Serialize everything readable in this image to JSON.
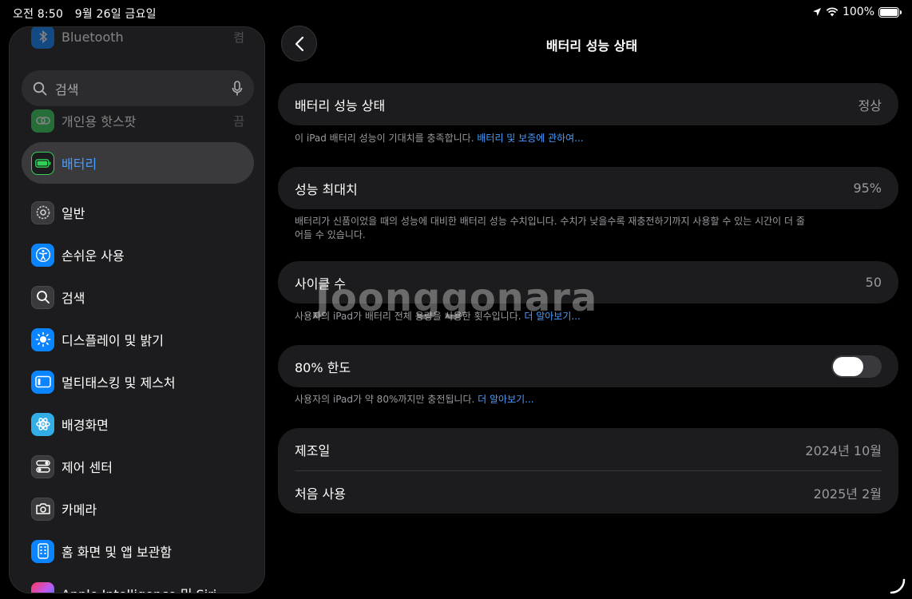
{
  "status_bar": {
    "time": "오전 8:50",
    "date": "9월 26일 금요일",
    "battery_percent": "100%"
  },
  "sidebar": {
    "search_placeholder": "검색",
    "items": [
      {
        "label": "Bluetooth",
        "value": "켬",
        "icon": "bluetooth-icon"
      },
      {
        "label": "개인용 핫스팟",
        "value": "끔",
        "icon": "link-icon"
      },
      {
        "label": "배터리",
        "value": "",
        "icon": "battery-icon",
        "selected": true
      },
      {
        "label": "일반",
        "value": "",
        "icon": "gear-icon"
      },
      {
        "label": "손쉬운 사용",
        "value": "",
        "icon": "accessibility-icon"
      },
      {
        "label": "검색",
        "value": "",
        "icon": "search-icon"
      },
      {
        "label": "디스플레이 및 밝기",
        "value": "",
        "icon": "sun-icon"
      },
      {
        "label": "멀티태스킹 및 제스처",
        "value": "",
        "icon": "multitasking-icon"
      },
      {
        "label": "배경화면",
        "value": "",
        "icon": "flower-icon"
      },
      {
        "label": "제어 센터",
        "value": "",
        "icon": "toggles-icon"
      },
      {
        "label": "카메라",
        "value": "",
        "icon": "camera-icon"
      },
      {
        "label": "홈 화면 및 앱 보관함",
        "value": "",
        "icon": "home-screen-icon"
      },
      {
        "label": "Apple Intelligence 및 Siri",
        "value": "",
        "icon": "siri-icon"
      }
    ]
  },
  "main": {
    "title": "배터리 성능 상태",
    "health": {
      "label": "배터리 성능 상태",
      "value": "정상"
    },
    "health_note": "이 iPad 배터리 성능이 기대치를 충족합니다.",
    "health_link": "배터리 및 보증에 관하여...",
    "max_capacity": {
      "label": "성능 최대치",
      "value": "95%"
    },
    "max_capacity_note": "배터리가 신품이었을 때의 성능에 대비한 배터리 성능 수치입니다. 수치가 낮을수록 재충전하기까지 사용할 수 있는 시간이 더 줄어들 수 있습니다.",
    "cycle": {
      "label": "사이클 수",
      "value": "50"
    },
    "cycle_note": "사용자의 iPad가 배터리 전체 용량을 사용한 횟수입니다.",
    "cycle_link": "더 알아보기...",
    "limit": {
      "label": "80% 한도",
      "enabled": false
    },
    "limit_note": "사용자의 iPad가 약 80%까지만 충전됩니다.",
    "limit_link": "더 알아보기...",
    "manufactured": {
      "label": "제조일",
      "value": "2024년 10월"
    },
    "first_use": {
      "label": "처음 사용",
      "value": "2025년 2월"
    }
  },
  "watermark": "Joonggonara",
  "colors": {
    "accent": "#0a84ff",
    "green": "#30d158",
    "card": "#1c1c1e"
  }
}
